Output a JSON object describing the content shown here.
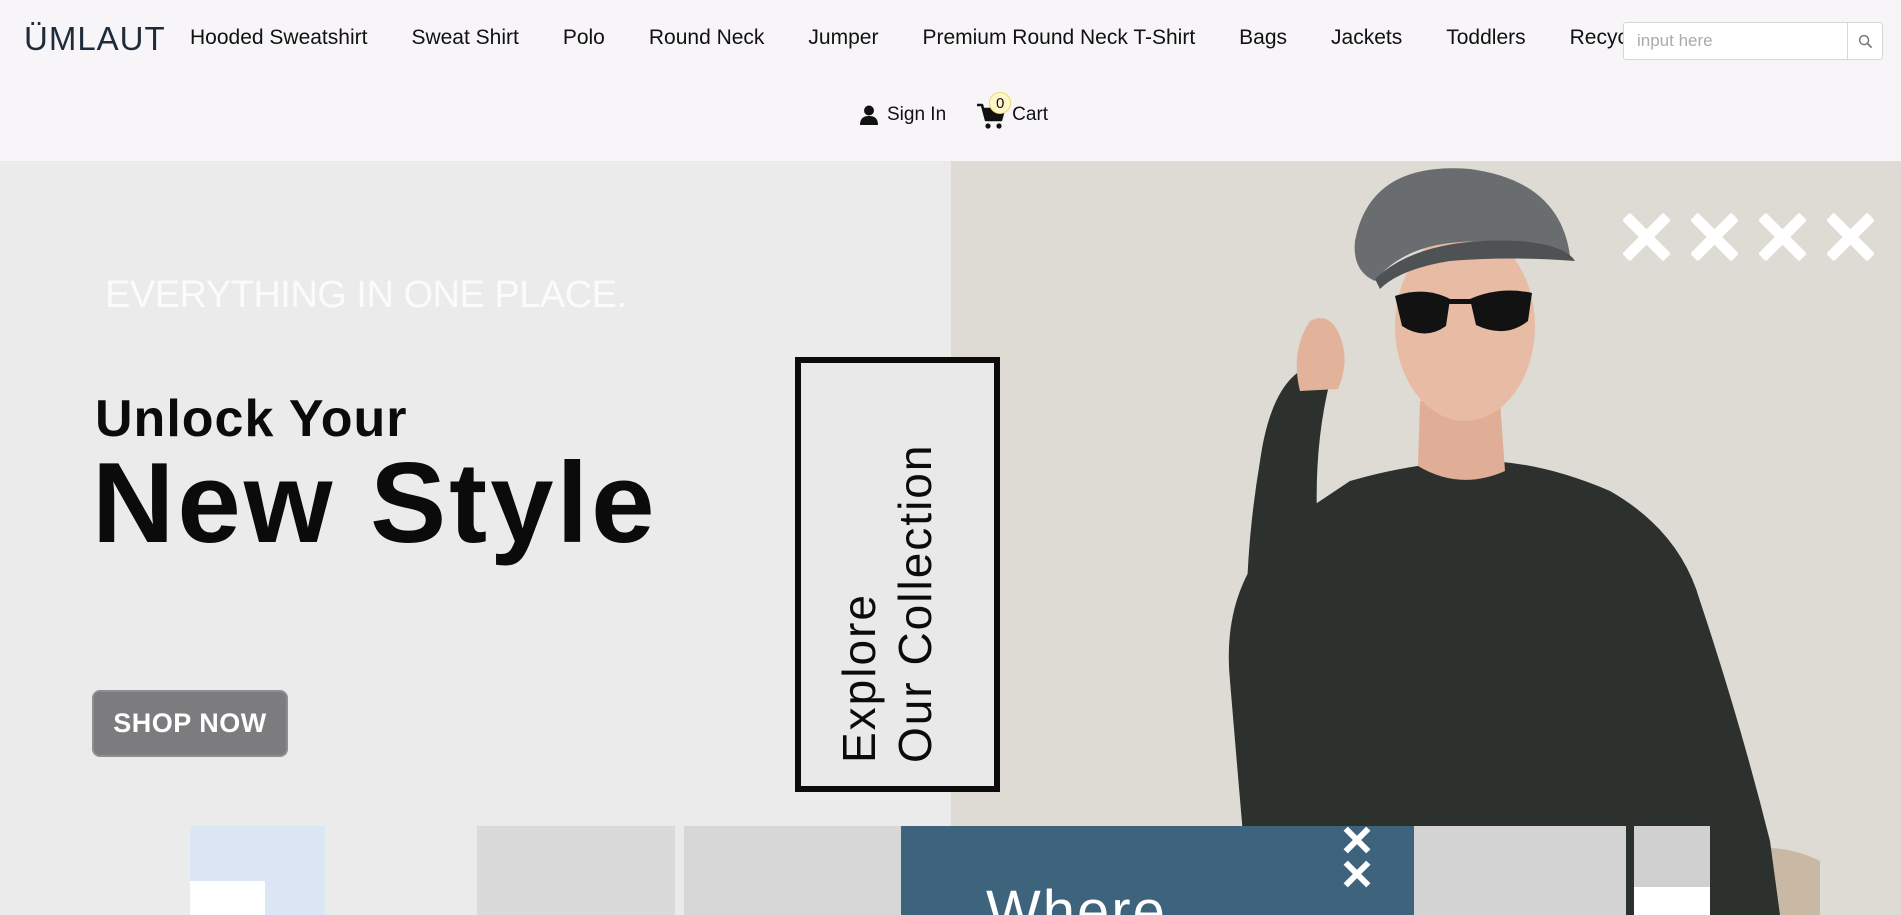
{
  "header": {
    "logo": "ÜMLAUT",
    "nav": [
      {
        "label": "Hooded Sweatshirt"
      },
      {
        "label": "Sweat Shirt"
      },
      {
        "label": "Polo"
      },
      {
        "label": "Round Neck"
      },
      {
        "label": "Jumper"
      },
      {
        "label": "Premium Round Neck T-Shirt"
      },
      {
        "label": "Bags"
      },
      {
        "label": "Jackets"
      },
      {
        "label": "Toddlers"
      },
      {
        "label": "Recycle"
      }
    ],
    "search": {
      "placeholder": "input here",
      "value": ""
    },
    "signin_label": "Sign In",
    "cart_label": "Cart",
    "cart_count": "0"
  },
  "hero": {
    "tagline": "EVERYTHING IN ONE PLACE.",
    "headline_small": "Unlock Your",
    "headline_large": "New Style",
    "shop_button": "SHOP NOW",
    "explore_line1": "Explore",
    "explore_line2": "Our Collection",
    "colors": {
      "left_bg": "#ebebeb",
      "right_bg": "#dedbd5",
      "button": "#7c7b7e"
    }
  },
  "promo": {
    "tile_text": "Where",
    "tile_color": "#3e637c"
  }
}
